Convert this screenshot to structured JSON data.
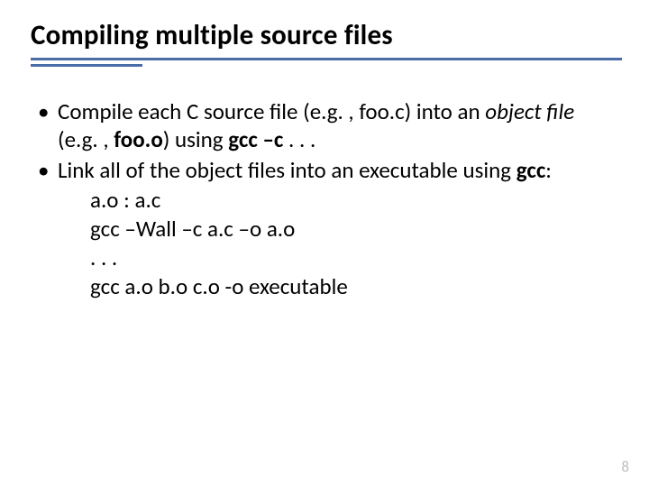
{
  "title": "Compiling multiple source files",
  "bullet1": {
    "a": "Compile each C source file (e.g. , foo.c) into an ",
    "b": "object file",
    "c": " (e.g. , ",
    "d": "foo.o",
    "e": ") using ",
    "f": "gcc –c",
    "g": " . . ."
  },
  "bullet2": {
    "a": "Link all of the object files into an executable using ",
    "b": "gcc",
    "c": ":"
  },
  "code": {
    "l1": "a.o : a.c",
    "l2": " gcc –Wall –c a.c –o a.o",
    "l3": ". . .",
    "l4": "gcc  a.o  b.o  c.o  -o executable"
  },
  "page": "8"
}
